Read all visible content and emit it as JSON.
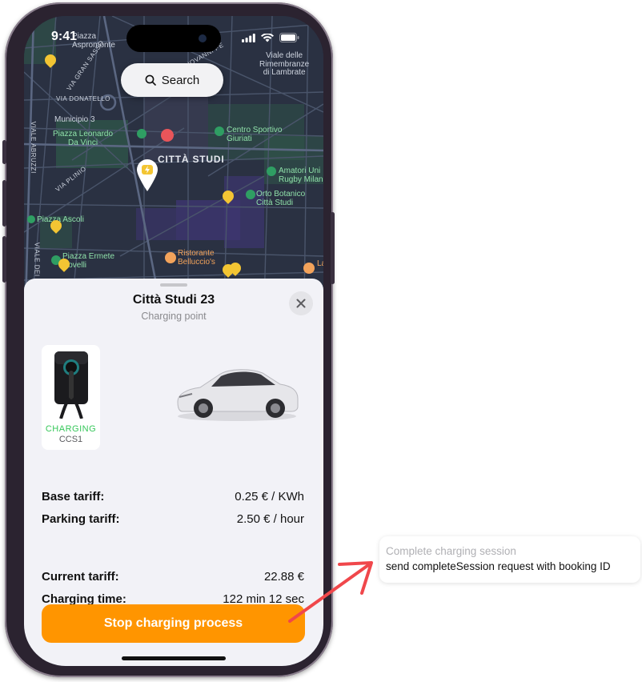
{
  "status_bar": {
    "time": "9:41"
  },
  "search": {
    "label": "Search"
  },
  "map": {
    "labels": [
      "Piazza\nAspromonte",
      "Viale delle\nRimembranze\ndi Lambrate",
      "VIA DONATELLO",
      "Municipio 3",
      "Piazza Leonardo\nDa Vinci",
      "CITTÀ STUDI",
      "Centro Sportivo\nGiuriati",
      "Amatori Uni\nRugby Milan",
      "Orto Botanico\nCittà Studi",
      "Piazza Ascoli",
      "Piazza Ermete\nNovelli",
      "Ristorante\nBelluccio's",
      "VIALE ABRUZZI",
      "VIA PLINIO",
      "VIALE DEI",
      "VIA GRAN SASSO",
      "GIOVANNI PE",
      "La"
    ]
  },
  "sheet": {
    "title": "Città Studi 23",
    "subtitle": "Charging point",
    "charger": {
      "status": "CHARGING",
      "type": "CCS1"
    },
    "tariffs": [
      {
        "label": "Base tariff:",
        "value": "0.25 € / KWh"
      },
      {
        "label": "Parking tariff:",
        "value": "2.50 € / hour"
      }
    ],
    "session": [
      {
        "label": "Current tariff:",
        "value": "22.88 €"
      },
      {
        "label": "Charging time:",
        "value": "122 min 12 sec"
      }
    ],
    "stop_button": "Stop charging process"
  },
  "annotation": {
    "title": "Complete charging session",
    "body": "send completeSession request with booking ID"
  },
  "colors": {
    "accent": "#ff9500",
    "charging": "#35c759",
    "arrow": "#f0474b",
    "marker": "#f3c533"
  },
  "icons": [
    "search-icon",
    "close-icon",
    "charging-station-marker-icon",
    "restaurant-icon",
    "park-icon",
    "signal-icon",
    "wifi-icon",
    "battery-icon"
  ]
}
